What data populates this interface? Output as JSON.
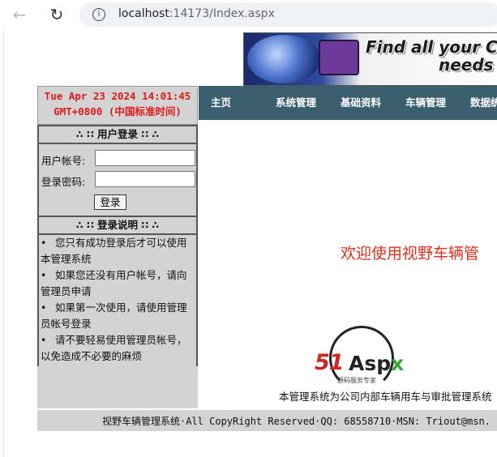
{
  "browser": {
    "url_host": "localhost",
    "url_rest": ":14173/Index.aspx"
  },
  "banner": {
    "line1": "Find all your C",
    "line2": "needs"
  },
  "clock": {
    "line1": "Tue Apr 23 2024 14:01:45",
    "line2": "GMT+0800 (中国标准时间)"
  },
  "login": {
    "title": "∴ ∷ 用户登录 ∷ ∴",
    "username_label": "用户帐号:",
    "password_label": "登录密码:",
    "submit_label": "登录"
  },
  "notes": {
    "title": "∴ ∷ 登录说明 ∷ ∴",
    "bullet": "•",
    "items": [
      "您只有成功登录后才可以使用本管理系统",
      "如果您还没有用户帐号，请向管理员申请",
      "如果第一次使用，请使用管理员帐号登录",
      "请不要轻易使用管理员帐号，以免造成不必要的麻烦"
    ]
  },
  "menu": {
    "items": [
      "主页",
      "系统管理",
      "基础资料",
      "车辆管理",
      "数据统"
    ]
  },
  "main": {
    "welcome": "欢迎使用视野车辆管",
    "logo_51": "51",
    "logo_asp": "Asp",
    "logo_x": "x",
    "logo_sub": "源码服务专家",
    "description": "本管理系统为公司内部车辆用车与审批管理系统"
  },
  "footer": {
    "text": "视野车辆管理系统·All CopyRight Reserved·QQ: 68558710·MSN: Triout@msn."
  }
}
